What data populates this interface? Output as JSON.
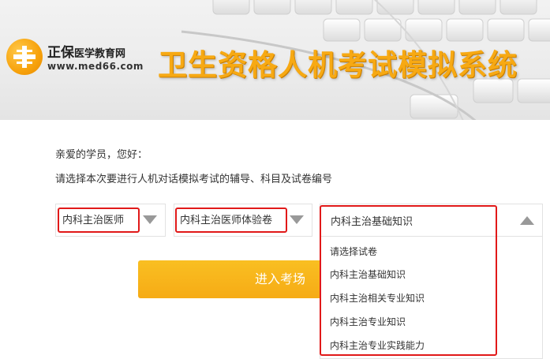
{
  "banner": {
    "logo_name": "正保",
    "logo_name_sub": "医学教育网",
    "logo_url": "www.med66.com",
    "title": "卫生资格人机考试模拟系统"
  },
  "greeting": "亲爱的学员，您好：",
  "instruction": "请选择本次要进行人机对话模拟考试的辅导、科目及试卷编号",
  "selects": {
    "coaching": {
      "selected": "内科主治医师"
    },
    "subject": {
      "selected": "内科主治医师体验卷"
    },
    "paper": {
      "selected": "内科主治基础知识",
      "options": [
        "请选择试卷",
        "内科主治基础知识",
        "内科主治相关专业知识",
        "内科主治专业知识",
        "内科主治专业实践能力"
      ]
    }
  },
  "enter_button": "进入考场",
  "colors": {
    "accent_orange": "#f7a913",
    "highlight_red": "#e11919",
    "button_orange": "#f6ab15"
  },
  "icons": [
    "logo-cross-icon",
    "dropdown-arrow-icon"
  ]
}
